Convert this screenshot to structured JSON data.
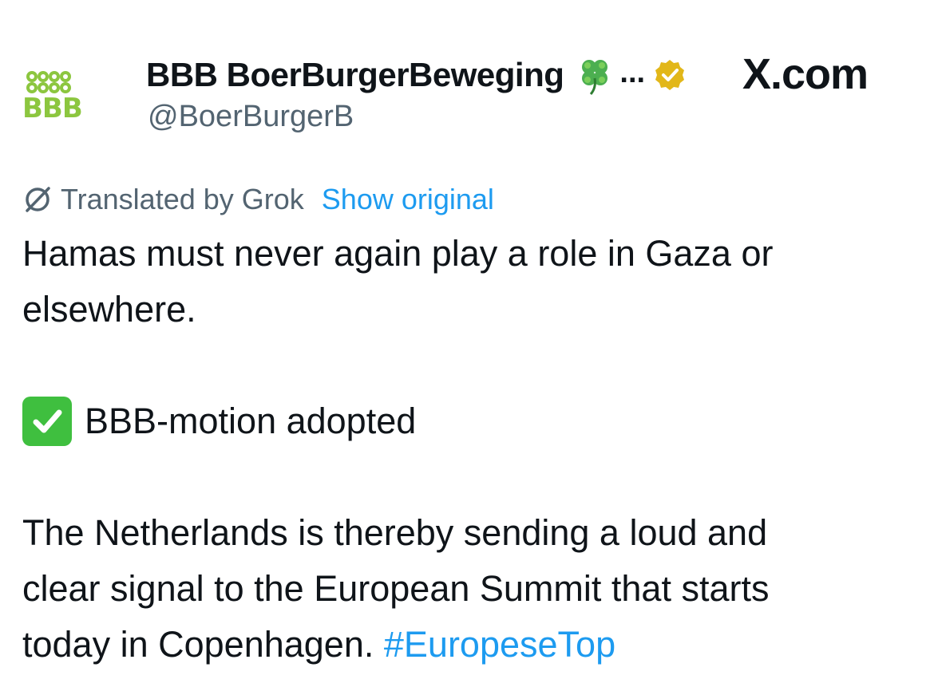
{
  "header": {
    "logo_text": "BBB",
    "display_name": "BBB BoerBurgerBeweging",
    "truncation": "...",
    "handle": "@BoerBurgerB",
    "watermark": "X.com"
  },
  "translation": {
    "label": "Translated by Grok",
    "show_original": "Show original"
  },
  "post": {
    "para1_line1": "Hamas must never again play a role in Gaza or",
    "para1_line2": "elsewhere.",
    "motion": "BBB-motion adopted",
    "para3_line1": "The Netherlands is thereby sending a loud and",
    "para3_line2": "clear signal to the European Summit that starts",
    "para3_line3": "today in Copenhagen.",
    "hashtag": "#EuropeseTop"
  },
  "colors": {
    "brand_green": "#8cc63f",
    "link_blue": "#1d9bf0",
    "secondary_text": "#536471",
    "verified_gold": "#e2b719"
  },
  "icons": {
    "clover": "four-leaf-clover-icon",
    "verified": "verified-badge-icon",
    "translate": "translate-icon",
    "check": "check-mark-icon"
  }
}
